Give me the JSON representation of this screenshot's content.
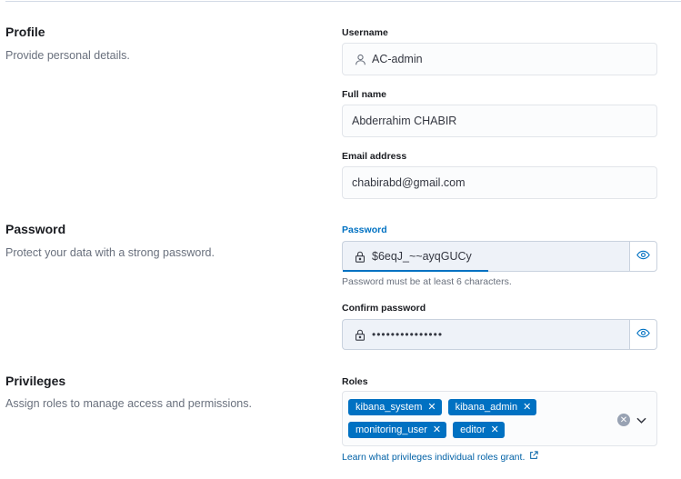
{
  "profile": {
    "title": "Profile",
    "description": "Provide personal details.",
    "username": {
      "label": "Username",
      "value": "AC-admin",
      "icon": "user-icon"
    },
    "full_name": {
      "label": "Full name",
      "value": "Abderrahim CHABIR"
    },
    "email": {
      "label": "Email address",
      "value": "chabirabd@gmail.com"
    }
  },
  "password": {
    "title": "Password",
    "description": "Protect your data with a strong password.",
    "password_field": {
      "label": "Password",
      "value": "$6eqJ_~~ayqGUCy",
      "help": "Password must be at least 6 characters."
    },
    "confirm_field": {
      "label": "Confirm password",
      "value": "•••••••••••••••"
    }
  },
  "privileges": {
    "title": "Privileges",
    "description": "Assign roles to manage access and permissions.",
    "roles_label": "Roles",
    "roles": [
      "kibana_system",
      "kibana_admin",
      "monitoring_user",
      "editor"
    ],
    "chip_remove": "✕",
    "clear_glyph": "✕",
    "learn_link": "Learn what privileges individual roles grant."
  },
  "colors": {
    "accent": "#0071c2",
    "field_bg": "#fbfcfd",
    "text_subdued": "#69707d"
  }
}
